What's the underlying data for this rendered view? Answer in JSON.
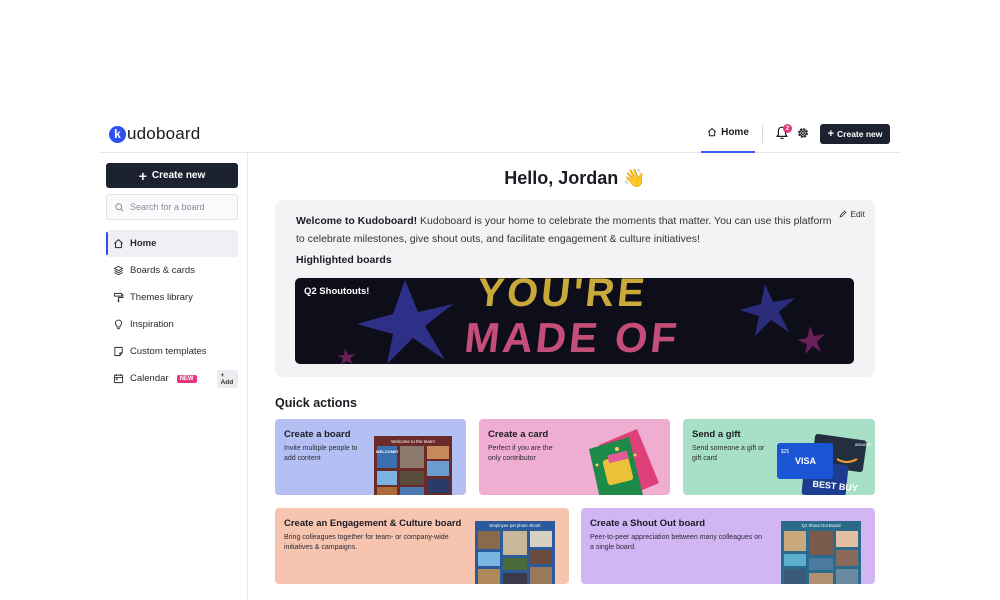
{
  "header": {
    "logo_letter": "k",
    "logo_text": "udoboard",
    "nav_home": "Home",
    "notifications_count": "2",
    "create_new": "Create new"
  },
  "sidebar": {
    "create_new": "Create new",
    "search_placeholder": "Search for a board",
    "items": [
      {
        "label": "Home",
        "icon": "home-icon",
        "active": true
      },
      {
        "label": "Boards & cards",
        "icon": "layers-icon"
      },
      {
        "label": "Themes library",
        "icon": "paint-roller-icon"
      },
      {
        "label": "Inspiration",
        "icon": "lightbulb-icon"
      },
      {
        "label": "Custom templates",
        "icon": "template-icon"
      },
      {
        "label": "Calendar",
        "icon": "calendar-icon",
        "badge": "NEW",
        "action": "+ Add"
      }
    ]
  },
  "main": {
    "greeting": "Hello, Jordan 👋",
    "welcome": {
      "edit": "Edit",
      "intro_bold": "Welcome to Kudoboard!",
      "intro_rest": " Kudoboard is your home to celebrate the moments that matter. You can use this platform to celebrate milestones, give shout outs, and facilitate engagement & culture initiatives!",
      "highlighted_label": "Highlighted boards",
      "banner_title": "Q2 Shoutouts!",
      "banner_art_line1": "YOU'RE",
      "banner_art_line2": "MADE OF"
    },
    "quick_actions_title": "Quick actions",
    "quick_actions": [
      {
        "title": "Create a board",
        "desc1": "Invite multiple people to",
        "desc2": "add content",
        "thumb_caption": "Welcome to the team!",
        "thumb_badge": "WELCOME!"
      },
      {
        "title": "Create a card",
        "desc1": "Perfect if you are the",
        "desc2": "only contributor"
      },
      {
        "title": "Send a gift",
        "desc1": "Send someone a gift or",
        "desc2": "gift card",
        "gift_visa": "VISA",
        "gift_bestbuy": "BEST BUY",
        "gift_amount": "$25",
        "gift_amazon": "amazon"
      },
      {
        "title": "Create an Engagement & Culture board",
        "desc1": "Bring colleagues together for team- or company-wide",
        "desc2": "initiatives & campaigns.",
        "thumb_caption": "Employee pet photo shoot!"
      },
      {
        "title": "Create a Shout Out board",
        "desc1": "Peer-to-peer appreciation between many colleagues on",
        "desc2": "a single board.",
        "thumb_caption": "Q1 Shout Out Board"
      }
    ]
  },
  "colors": {
    "brand_blue": "#2d4ff2",
    "dark_button": "#1c2230",
    "pink_badge": "#e5357d"
  }
}
